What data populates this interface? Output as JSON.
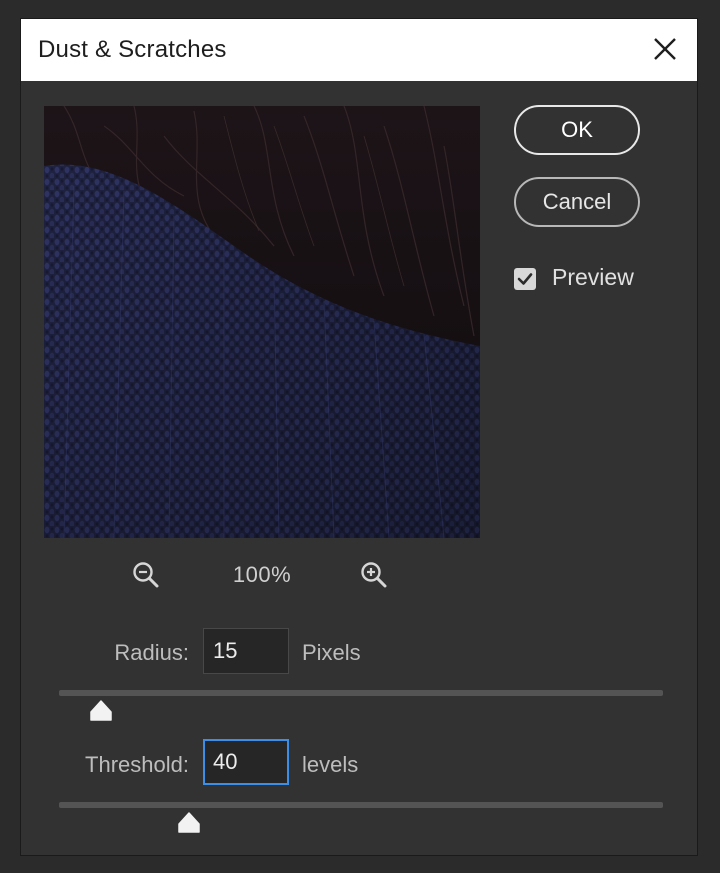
{
  "dialog": {
    "title": "Dust & Scratches"
  },
  "buttons": {
    "ok_label": "OK",
    "cancel_label": "Cancel"
  },
  "preview_toggle": {
    "label": "Preview",
    "checked": true
  },
  "zoom": {
    "level": "100%"
  },
  "radius": {
    "label": "Radius:",
    "value": "15",
    "unit": "Pixels",
    "slider_fraction": 0.07
  },
  "threshold": {
    "label": "Threshold:",
    "value": "40",
    "unit": "levels",
    "slider_fraction": 0.215,
    "focused": true
  },
  "icons": {
    "close": "close-icon",
    "check": "checkmark-icon",
    "zoom_out": "zoom-out-icon",
    "zoom_in": "zoom-in-icon"
  },
  "colors": {
    "focus_ring": "#3d8ee8",
    "background": "#323232",
    "titlebar": "#ffffff"
  }
}
